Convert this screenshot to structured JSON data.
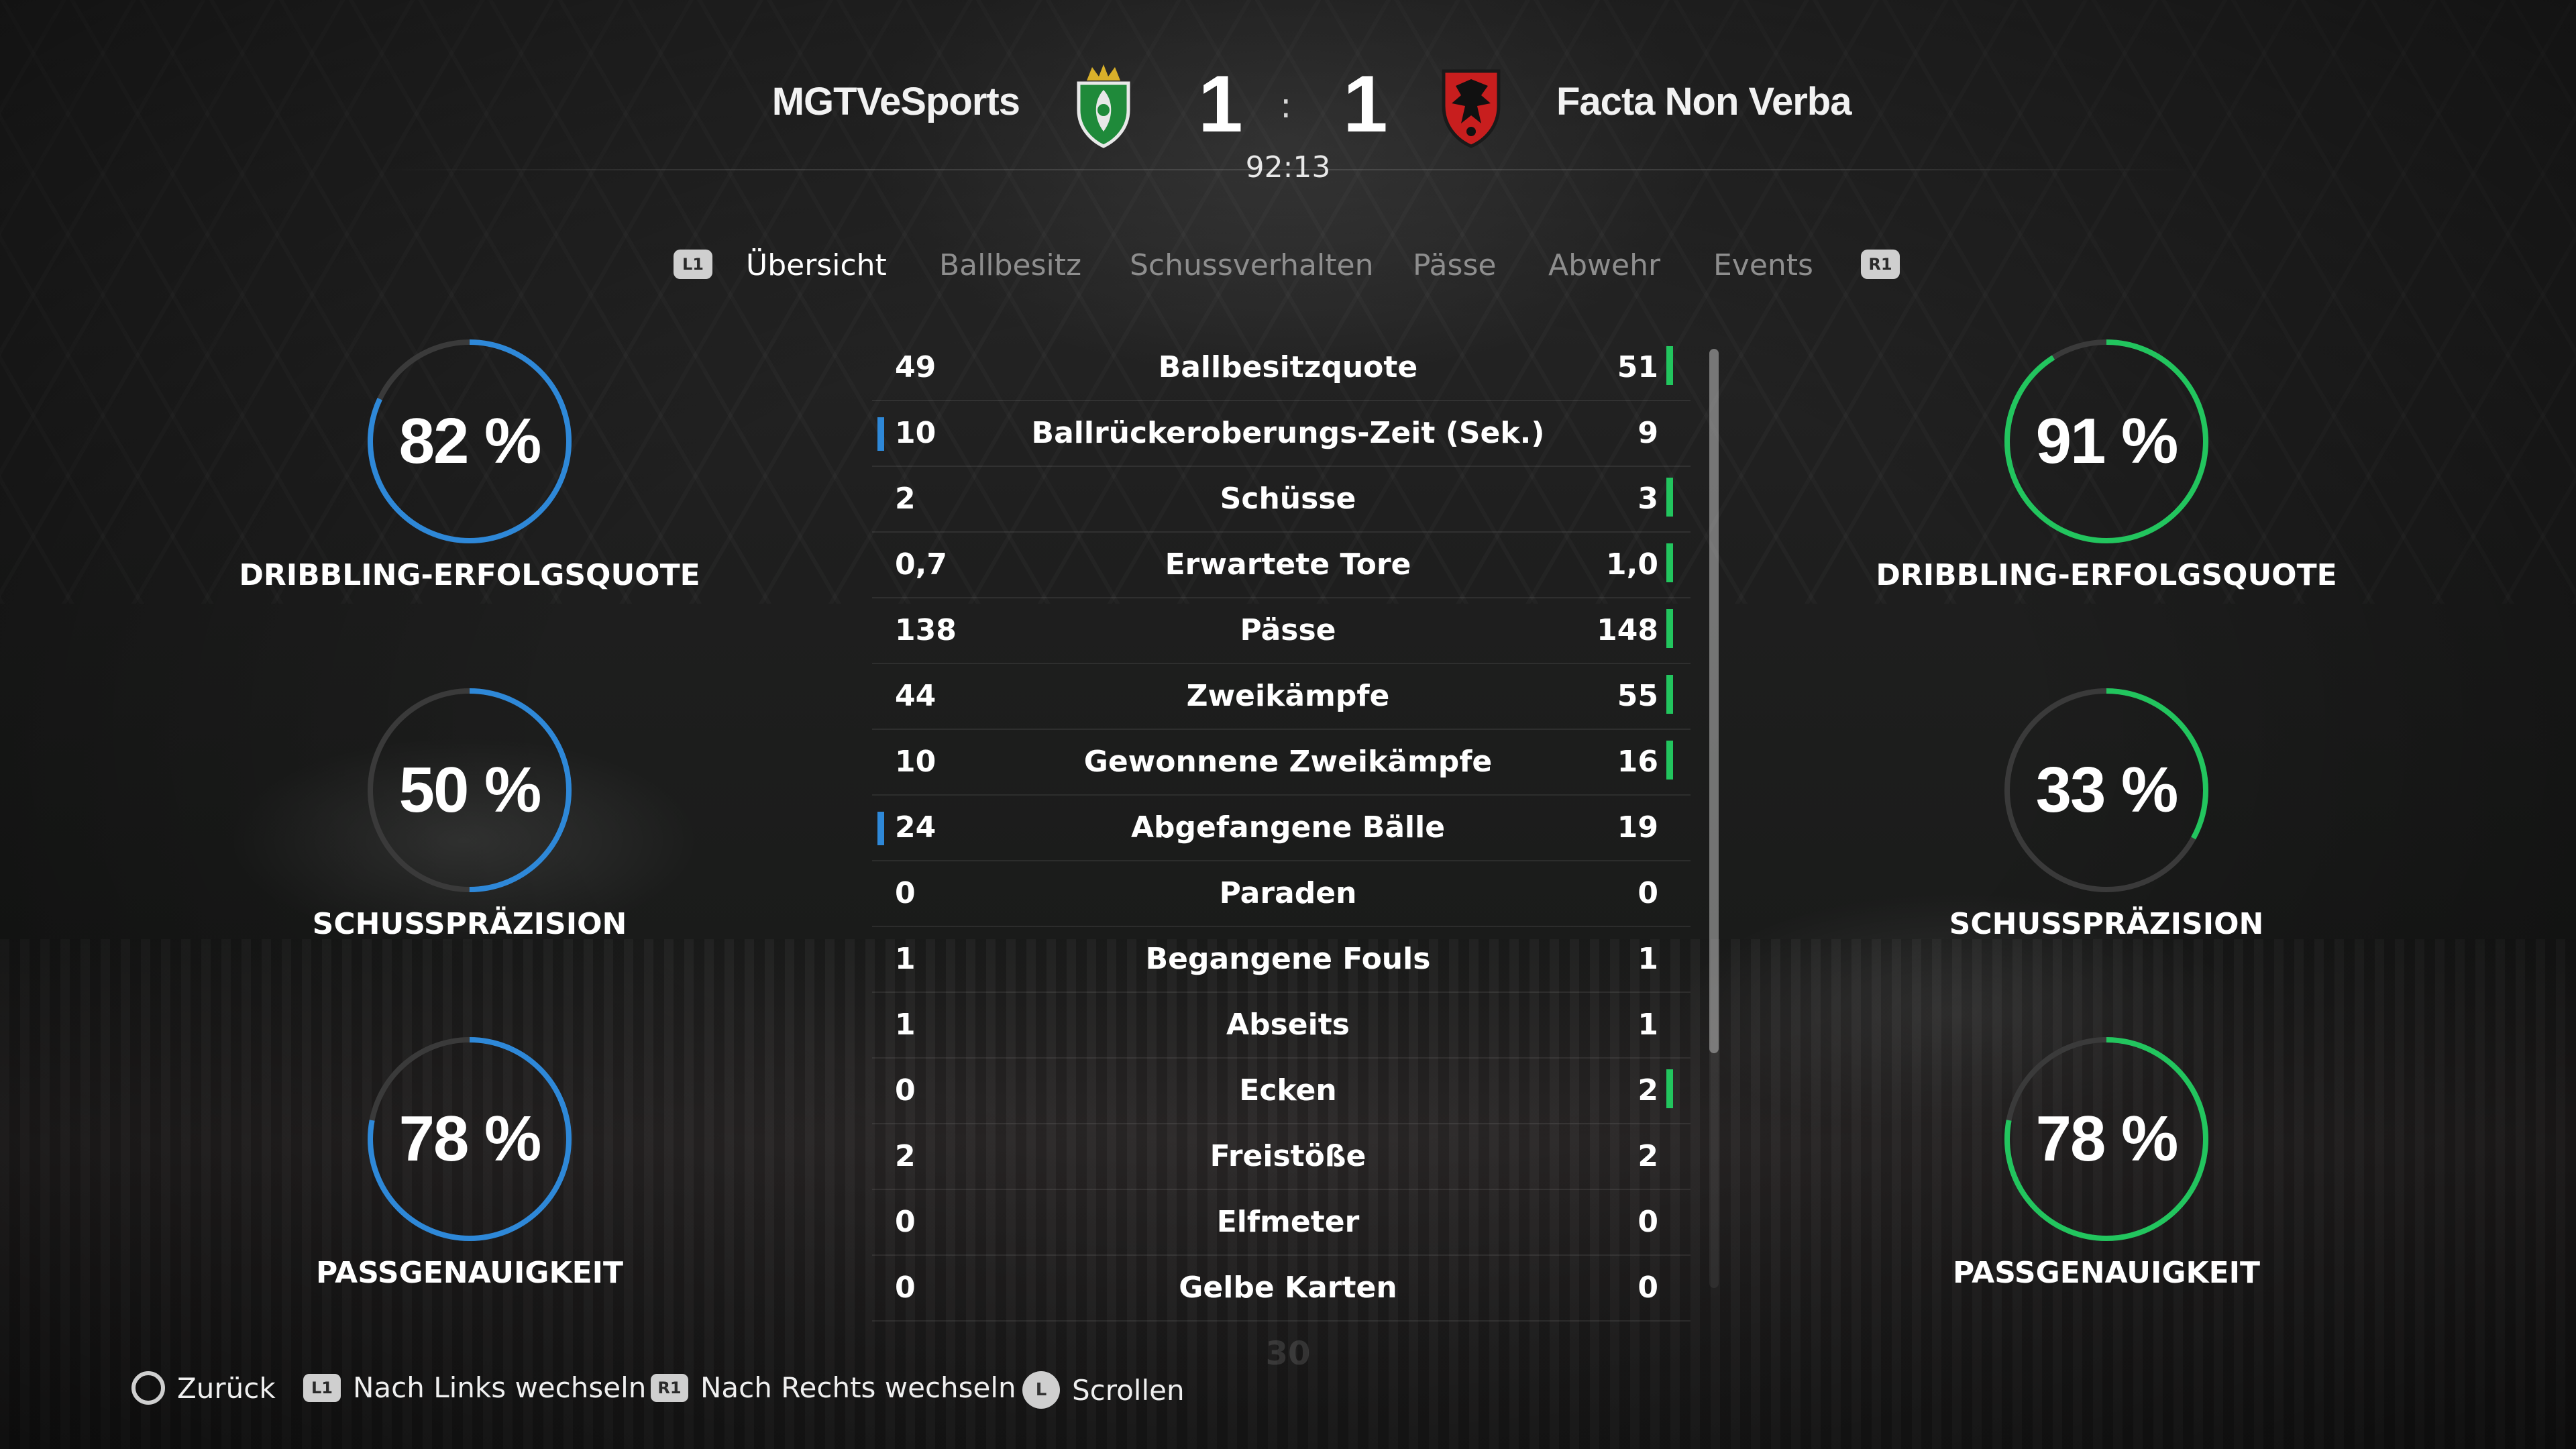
{
  "colors": {
    "home": "#2e88d8",
    "away": "#22c55e",
    "ring_track": "#3a3a3a"
  },
  "match": {
    "home": {
      "name": "MGTVeSports",
      "score": "1",
      "crest_icon": "green-shield-crown-crest-icon"
    },
    "away": {
      "name": "Facta Non Verba",
      "score": "1",
      "crest_icon": "red-black-eagle-crest-icon"
    },
    "separator": ":",
    "time": "92:13"
  },
  "tabs": {
    "left_button": "L1",
    "right_button": "R1",
    "items": [
      "Übersicht",
      "Ballbesitz",
      "Schussverhalten",
      "Pässe",
      "Abwehr",
      "Events"
    ],
    "active": "Übersicht"
  },
  "home_rings": [
    {
      "value": "82 %",
      "percent": 82,
      "label": "DRIBBLING-ERFOLGSQUOTE"
    },
    {
      "value": "50 %",
      "percent": 50,
      "label": "SCHUSSPRÄZISION"
    },
    {
      "value": "78 %",
      "percent": 78,
      "label": "PASSGENAUIGKEIT"
    }
  ],
  "away_rings": [
    {
      "value": "91 %",
      "percent": 91,
      "label": "DRIBBLING-ERFOLGSQUOTE"
    },
    {
      "value": "33 %",
      "percent": 33,
      "label": "SCHUSSPRÄZISION"
    },
    {
      "value": "78 %",
      "percent": 78,
      "label": "PASSGENAUIGKEIT"
    }
  ],
  "stats": [
    {
      "label": "Ballbesitzquote",
      "home": "49",
      "away": "51",
      "leader": "away"
    },
    {
      "label": "Ballrückeroberungs-Zeit (Sek.)",
      "home": "10",
      "away": "9",
      "leader": "home"
    },
    {
      "label": "Schüsse",
      "home": "2",
      "away": "3",
      "leader": "away"
    },
    {
      "label": "Erwartete Tore",
      "home": "0,7",
      "away": "1,0",
      "leader": "away"
    },
    {
      "label": "Pässe",
      "home": "138",
      "away": "148",
      "leader": "away"
    },
    {
      "label": "Zweikämpfe",
      "home": "44",
      "away": "55",
      "leader": "away"
    },
    {
      "label": "Gewonnene Zweikämpfe",
      "home": "10",
      "away": "16",
      "leader": "away"
    },
    {
      "label": "Abgefangene Bälle",
      "home": "24",
      "away": "19",
      "leader": "home"
    },
    {
      "label": "Paraden",
      "home": "0",
      "away": "0",
      "leader": "none"
    },
    {
      "label": "Begangene Fouls",
      "home": "1",
      "away": "1",
      "leader": "none"
    },
    {
      "label": "Abseits",
      "home": "1",
      "away": "1",
      "leader": "none"
    },
    {
      "label": "Ecken",
      "home": "0",
      "away": "2",
      "leader": "away"
    },
    {
      "label": "Freistöße",
      "home": "2",
      "away": "2",
      "leader": "none"
    },
    {
      "label": "Elfmeter",
      "home": "0",
      "away": "0",
      "leader": "none"
    },
    {
      "label": "Gelbe Karten",
      "home": "0",
      "away": "0",
      "leader": "none"
    }
  ],
  "page_number": "30",
  "footer": {
    "back": {
      "icon": "circle-button-icon",
      "label": "Zurück"
    },
    "left": {
      "badge": "L1",
      "label": "Nach Links wechseln"
    },
    "right": {
      "badge": "R1",
      "label": "Nach Rechts wechseln"
    },
    "scroll": {
      "badge": "L",
      "label": "Scrollen"
    }
  }
}
